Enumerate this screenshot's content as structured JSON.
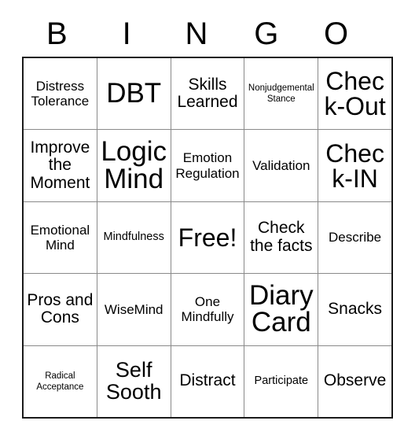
{
  "header": {
    "letters": [
      "B",
      "I",
      "N",
      "G",
      "O"
    ]
  },
  "grid": {
    "rows": [
      [
        {
          "text": "Distress Tolerance",
          "size": "s-md"
        },
        {
          "text": "DBT",
          "size": "s-max"
        },
        {
          "text": "Skills Learned",
          "size": "s-lg"
        },
        {
          "text": "Nonjudgemental Stance",
          "size": "s-xs"
        },
        {
          "text": "Check-Out",
          "size": "s-xxl"
        }
      ],
      [
        {
          "text": "Improve the Moment",
          "size": "s-lg"
        },
        {
          "text": "Logic Mind",
          "size": "s-max"
        },
        {
          "text": "Emotion Regulation",
          "size": "s-md"
        },
        {
          "text": "Validation",
          "size": "s-md"
        },
        {
          "text": "Check-IN",
          "size": "s-xxl"
        }
      ],
      [
        {
          "text": "Emotional Mind",
          "size": "s-md"
        },
        {
          "text": "Mindfulness",
          "size": "s-sm"
        },
        {
          "text": "Free!",
          "size": "s-xxl"
        },
        {
          "text": "Check the facts",
          "size": "s-lg"
        },
        {
          "text": "Describe",
          "size": "s-md"
        }
      ],
      [
        {
          "text": "Pros and Cons",
          "size": "s-lg"
        },
        {
          "text": "WiseMind",
          "size": "s-md"
        },
        {
          "text": "One Mindfully",
          "size": "s-md"
        },
        {
          "text": "Diary Card",
          "size": "s-max"
        },
        {
          "text": "Snacks",
          "size": "s-lg"
        }
      ],
      [
        {
          "text": "Radical Acceptance",
          "size": "s-xs"
        },
        {
          "text": "Self Sooth",
          "size": "s-xl"
        },
        {
          "text": "Distract",
          "size": "s-lg"
        },
        {
          "text": "Participate",
          "size": "s-sm"
        },
        {
          "text": "Observe",
          "size": "s-lg"
        }
      ]
    ]
  },
  "colors": {
    "outer_border": "#1b1b1b",
    "inner_border": "#8a8a8a",
    "text": "#000000",
    "background": "#ffffff"
  }
}
